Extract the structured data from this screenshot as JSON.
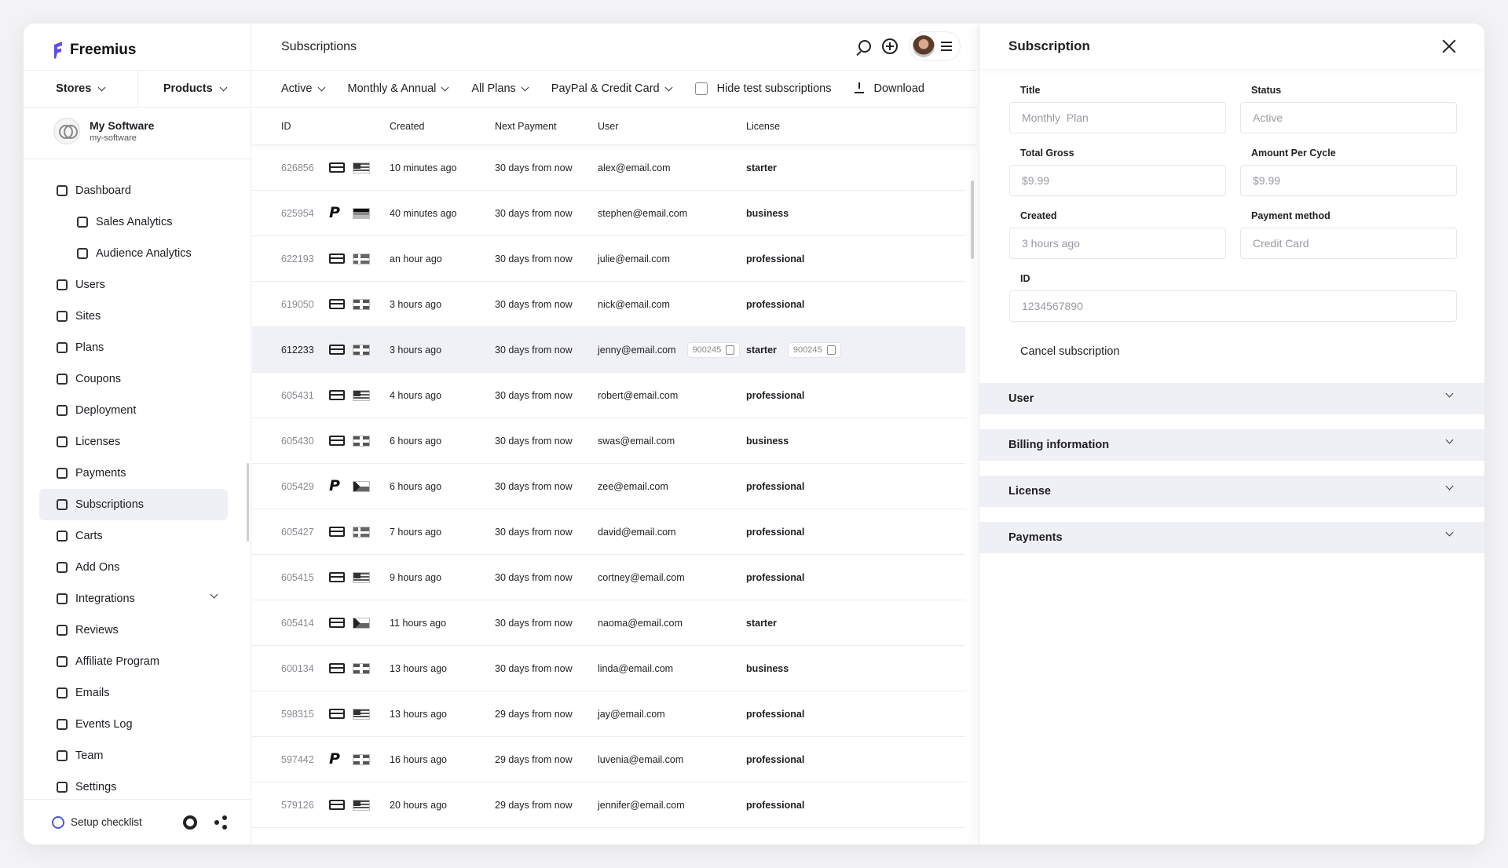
{
  "brand": {
    "name": "Freemius",
    "accent": "#5b4fe6"
  },
  "sidebar": {
    "stores_label": "Stores",
    "products_label": "Products",
    "app": {
      "name": "My Software",
      "slug": "my-software"
    },
    "items": [
      {
        "label": "Dashboard",
        "icon": "dashboard-icon"
      },
      {
        "label": "Sales Analytics",
        "icon": "chart-icon"
      },
      {
        "label": "Audience Analytics",
        "icon": "chart-icon"
      },
      {
        "label": "Users",
        "icon": "users-icon"
      },
      {
        "label": "Sites",
        "icon": "sites-icon"
      },
      {
        "label": "Plans",
        "icon": "plans-icon"
      },
      {
        "label": "Coupons",
        "icon": "coupon-icon"
      },
      {
        "label": "Deployment",
        "icon": "deployment-icon"
      },
      {
        "label": "Licenses",
        "icon": "key-icon"
      },
      {
        "label": "Payments",
        "icon": "payments-icon"
      },
      {
        "label": "Subscriptions",
        "icon": "subscriptions-icon"
      },
      {
        "label": "Carts",
        "icon": "cart-icon"
      },
      {
        "label": "Add Ons",
        "icon": "addons-icon"
      },
      {
        "label": "Integrations",
        "icon": "integrations-icon"
      },
      {
        "label": "Reviews",
        "icon": "reviews-icon"
      },
      {
        "label": "Affiliate Program",
        "icon": "affiliate-icon"
      },
      {
        "label": "Emails",
        "icon": "mail-icon"
      },
      {
        "label": "Events Log",
        "icon": "events-icon"
      },
      {
        "label": "Team",
        "icon": "team-icon"
      },
      {
        "label": "Settings",
        "icon": "settings-icon"
      }
    ],
    "footer": {
      "setup_label": "Setup checklist"
    }
  },
  "main": {
    "title": "Subscriptions",
    "filters": {
      "status": "Active",
      "cycle": "Monthly & Annual",
      "plans": "All Plans",
      "gateway": "PayPal & Credit Card",
      "hide_test": "Hide test subscriptions",
      "download": "Download"
    },
    "columns": [
      "ID",
      "Created",
      "Next Payment",
      "User",
      "License"
    ],
    "rows": [
      {
        "id": "626856",
        "method": "card",
        "flag": "us",
        "created": "10 minutes ago",
        "next": "30 days from now",
        "user": "alex@email.com",
        "license": "starter"
      },
      {
        "id": "625954",
        "method": "paypal",
        "flag": "de",
        "created": "40 minutes ago",
        "next": "30 days from now",
        "user": "stephen@email.com",
        "license": "business"
      },
      {
        "id": "622193",
        "method": "card",
        "flag": "se",
        "created": "an hour ago",
        "next": "30 days from now",
        "user": "julie@email.com",
        "license": "professional"
      },
      {
        "id": "619050",
        "method": "card",
        "flag": "gb",
        "created": "3 hours ago",
        "next": "30 days from now",
        "user": "nick@email.com",
        "license": "professional"
      },
      {
        "id": "612233",
        "method": "card",
        "flag": "gb",
        "created": "3 hours ago",
        "next": "30 days from now",
        "user": "jenny@email.com",
        "license": "starter",
        "user_chip": "900245",
        "license_chip": "900245"
      },
      {
        "id": "605431",
        "method": "card",
        "flag": "us",
        "created": "4 hours ago",
        "next": "30 days from now",
        "user": "robert@email.com",
        "license": "professional"
      },
      {
        "id": "605430",
        "method": "card",
        "flag": "gb",
        "created": "6 hours ago",
        "next": "30 days from now",
        "user": "swas@email.com",
        "license": "business"
      },
      {
        "id": "605429",
        "method": "paypal",
        "flag": "cz",
        "created": "6 hours ago",
        "next": "30 days from now",
        "user": "zee@email.com",
        "license": "professional"
      },
      {
        "id": "605427",
        "method": "card",
        "flag": "se",
        "created": "7 hours ago",
        "next": "30 days from now",
        "user": "david@email.com",
        "license": "professional"
      },
      {
        "id": "605415",
        "method": "card",
        "flag": "us",
        "created": "9 hours ago",
        "next": "30 days from now",
        "user": "cortney@email.com",
        "license": "professional"
      },
      {
        "id": "605414",
        "method": "card",
        "flag": "cz",
        "created": "11 hours ago",
        "next": "30 days from now",
        "user": "naoma@email.com",
        "license": "starter"
      },
      {
        "id": "600134",
        "method": "card",
        "flag": "gb",
        "created": "13 hours ago",
        "next": "30 days from now",
        "user": "linda@email.com",
        "license": "business"
      },
      {
        "id": "598315",
        "method": "card",
        "flag": "us",
        "created": "13 hours ago",
        "next": "29 days from now",
        "user": "jay@email.com",
        "license": "professional"
      },
      {
        "id": "597442",
        "method": "paypal",
        "flag": "gb",
        "created": "16 hours ago",
        "next": "29 days from now",
        "user": "luvenia@email.com",
        "license": "professional"
      },
      {
        "id": "579126",
        "method": "card",
        "flag": "us",
        "created": "20 hours ago",
        "next": "29 days from now",
        "user": "jennifer@email.com",
        "license": "professional"
      }
    ]
  },
  "panel": {
    "title": "Subscription",
    "fields": {
      "title_label": "Title",
      "title_value": "Monthly  Plan",
      "status_label": "Status",
      "status_value": "Active",
      "gross_label": "Total Gross",
      "gross_value": "$9.99",
      "cycle_label": "Amount Per Cycle",
      "cycle_value": "$9.99",
      "created_label": "Created",
      "created_value": "3 hours ago",
      "method_label": "Payment method",
      "method_value": "Credit Card",
      "id_label": "ID",
      "id_value": "1234567890"
    },
    "cancel_label": "Cancel subscription",
    "sections": [
      "User",
      "Billing information",
      "License",
      "Payments"
    ]
  }
}
